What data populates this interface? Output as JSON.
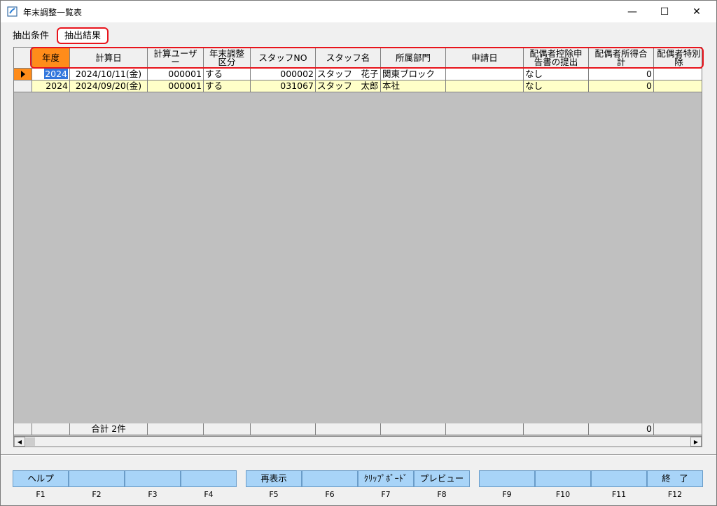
{
  "window": {
    "title": "年末調整一覧表",
    "minimize": "—",
    "maximize": "☐",
    "close": "✕"
  },
  "tabs": [
    {
      "label": "抽出条件"
    },
    {
      "label": "抽出結果"
    }
  ],
  "grid": {
    "columns": [
      "年度",
      "計算日",
      "計算ユーザー",
      "年末調整区分",
      "スタッフNO",
      "スタッフ名",
      "所属部門",
      "申請日",
      "配偶者控除申告書の提出",
      "配偶者所得合計",
      "配偶者特別控除"
    ],
    "header_lines": [
      [
        "年度"
      ],
      [
        "計算日"
      ],
      [
        "計算ユーザ",
        "ー"
      ],
      [
        "年末調整",
        "区分"
      ],
      [
        "スタッフNO"
      ],
      [
        "スタッフ名"
      ],
      [
        "所属部門"
      ],
      [
        "申請日"
      ],
      [
        "配偶者控除申",
        "告書の提出"
      ],
      [
        "配偶者所得合",
        "計"
      ],
      [
        "配偶者特別",
        "除"
      ]
    ],
    "rows": [
      {
        "year": "2024",
        "calc_date": "2024/10/11(金)",
        "user": "000001",
        "kubun": "する",
        "staff_no": "000002",
        "staff_name": "スタッフ　花子",
        "dept": "関東ブロック",
        "apply_date": "",
        "spouse_decl": "なし",
        "spouse_income": "0",
        "spouse_special": ""
      },
      {
        "year": "2024",
        "calc_date": "2024/09/20(金)",
        "user": "000001",
        "kubun": "する",
        "staff_no": "031067",
        "staff_name": "スタッフ　太郎",
        "dept": "本社",
        "apply_date": "",
        "spouse_decl": "なし",
        "spouse_income": "0",
        "spouse_special": ""
      }
    ],
    "footer": {
      "total_label": "合計 2件",
      "spouse_income_total": "0"
    }
  },
  "function_keys": [
    {
      "label": "ヘルプ",
      "key": "F1"
    },
    {
      "label": "",
      "key": "F2"
    },
    {
      "label": "",
      "key": "F3"
    },
    {
      "label": "",
      "key": "F4"
    },
    {
      "label": "再表示",
      "key": "F5"
    },
    {
      "label": "",
      "key": "F6"
    },
    {
      "label": "ｸﾘｯﾌﾟﾎﾞｰﾄﾞ",
      "key": "F7"
    },
    {
      "label": "プレビュー",
      "key": "F8"
    },
    {
      "label": "",
      "key": "F9"
    },
    {
      "label": "",
      "key": "F10"
    },
    {
      "label": "",
      "key": "F11"
    },
    {
      "label": "終　了",
      "key": "F12"
    }
  ],
  "colors": {
    "selected_header": "#ff8c1a",
    "alt_row": "#ffffc8",
    "annotation": "#e8141c",
    "fkey": "#a8d4f8"
  }
}
